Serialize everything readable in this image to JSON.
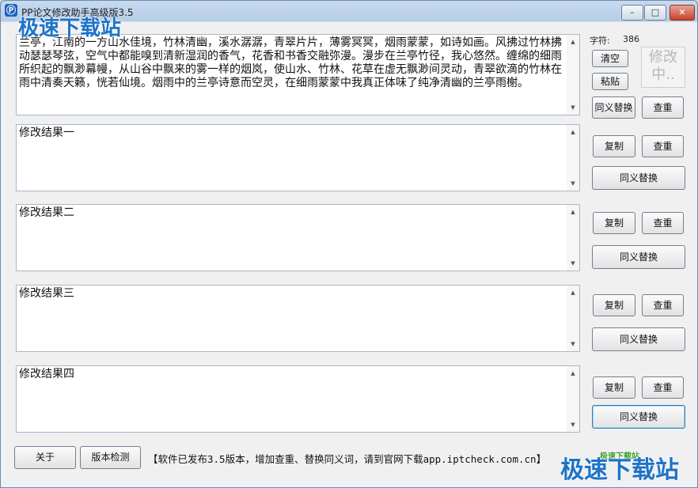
{
  "window": {
    "title": "PP论文修改助手高级版3.5",
    "icon": "app-logo-icon",
    "controls": {
      "minimize": "–",
      "maximize": "□",
      "close": "✕"
    }
  },
  "watermark": {
    "top_left": "极速下载站",
    "bottom_right": "极速下载站",
    "bottom_right_small": "极速下载站"
  },
  "input": {
    "text": "兰亭，江南的一方山水佳境，竹林清幽，溪水潺潺，青翠片片，薄雾冥冥，烟雨蒙蒙，如诗如画。风拂过竹林拂动瑟瑟琴弦，空气中都能嗅到清新湿润的香气，花香和书香交融弥漫。漫步在兰亭竹径，我心悠然。缠绵的细雨所织起的飘渺幕幔，从山谷中飘来的雾一样的烟岚，使山水、竹林、花草在虚无飘渺间灵动，青翠欲滴的竹林在雨中清奏天籁，恍若仙境。烟雨中的兰亭诗意而空灵，在细雨蒙蒙中我真正体味了纯净清幽的兰亭雨榭。",
    "char_count_label": "字符:",
    "char_count": "386",
    "clear_label": "清空",
    "paste_label": "粘贴",
    "synonym_label": "同义替换",
    "check_label": "查重",
    "status_badge": "修改中..",
    "status_hint": "修改"
  },
  "results": [
    {
      "text": "修改结果一",
      "copy_label": "复制",
      "check_label": "查重",
      "synonym_label": "同义替换"
    },
    {
      "text": "修改结果二",
      "copy_label": "复制",
      "check_label": "查重",
      "synonym_label": "同义替换"
    },
    {
      "text": "修改结果三",
      "copy_label": "复制",
      "check_label": "查重",
      "synonym_label": "同义替换"
    },
    {
      "text": "修改结果四",
      "copy_label": "复制",
      "check_label": "查重",
      "synonym_label": "同义替换"
    }
  ],
  "footer": {
    "about_label": "关于",
    "version_check_label": "版本检测",
    "notice": "【软件已发布3.5版本，增加查重、替换同义词，请到官网下载app.iptcheck.com.cn】"
  }
}
